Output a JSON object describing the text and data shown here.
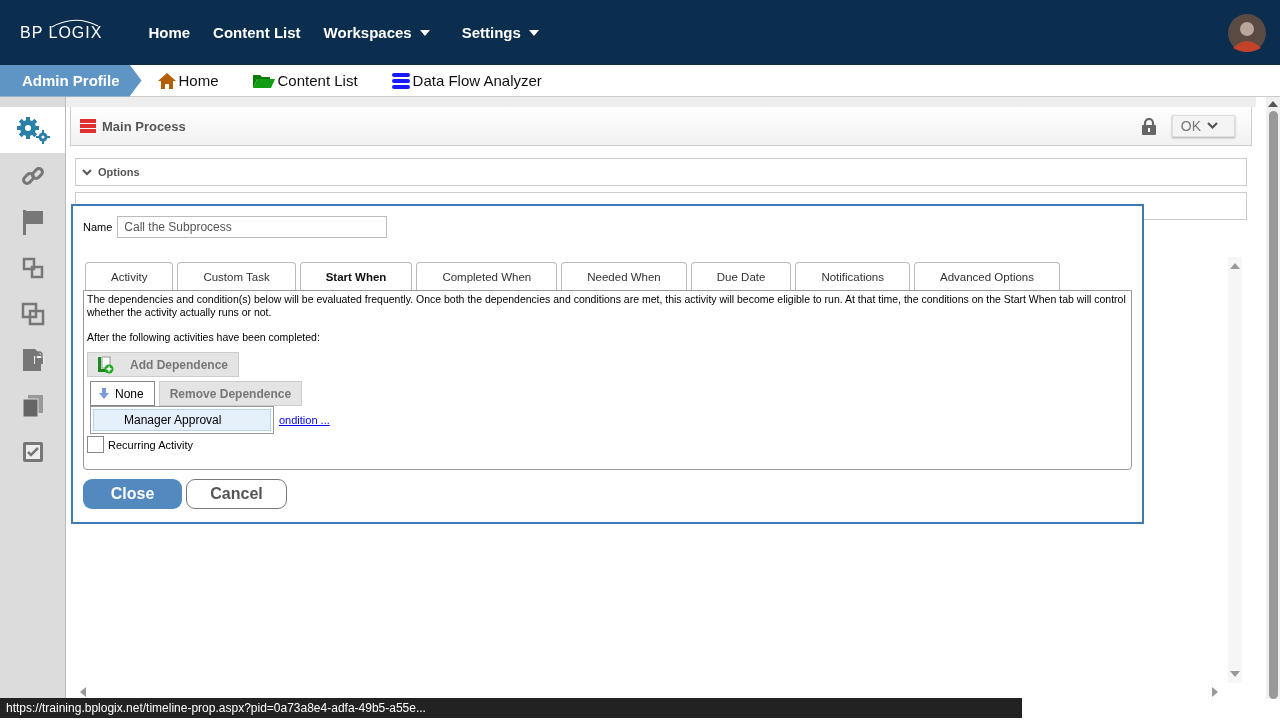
{
  "header": {
    "logo": "BP LOGIX",
    "nav": [
      {
        "label": "Home",
        "dropdown": false
      },
      {
        "label": "Content List",
        "dropdown": false
      },
      {
        "label": "Workspaces",
        "dropdown": true
      },
      {
        "label": "Settings",
        "dropdown": true
      }
    ]
  },
  "breadcrumb": {
    "profile": "Admin Profile",
    "links": [
      {
        "label": "Home",
        "kind": "home"
      },
      {
        "label": "Content List",
        "kind": "folder"
      },
      {
        "label": "Data Flow Analyzer",
        "kind": "database"
      }
    ]
  },
  "sidebar": {
    "items": [
      {
        "kind": "gears",
        "selected": true
      },
      {
        "kind": "link",
        "selected": false
      },
      {
        "kind": "flag",
        "selected": false
      },
      {
        "kind": "squares",
        "selected": false
      },
      {
        "kind": "overlap",
        "selected": false
      },
      {
        "kind": "lockdoc",
        "selected": false
      },
      {
        "kind": "copy",
        "selected": false
      },
      {
        "kind": "checkdoc",
        "selected": false
      }
    ]
  },
  "process": {
    "title": "Main Process",
    "ok_button": "OK"
  },
  "sections": [
    {
      "label": "Options"
    }
  ],
  "dialog": {
    "name_label": "Name",
    "name_value": "Call the Subprocess",
    "tabs": [
      {
        "label": "Activity",
        "selected": false
      },
      {
        "label": "Custom Task",
        "selected": false
      },
      {
        "label": "Start When",
        "selected": true
      },
      {
        "label": "Completed When",
        "selected": false
      },
      {
        "label": "Needed When",
        "selected": false
      },
      {
        "label": "Due Date",
        "selected": false
      },
      {
        "label": "Notifications",
        "selected": false
      },
      {
        "label": "Advanced Options",
        "selected": false
      }
    ],
    "description": "The dependencies and condition(s) below will be evaluated frequently. Once both the dependencies and conditions are met, this activity will become eligible to run. At that time, the conditions on the Start When tab will control whether the activity actually runs or not.",
    "after_text": "After the following activities have been completed:",
    "add_button": "Add Dependence",
    "dependence_value": "None",
    "remove_button": "Remove Dependence",
    "dropdown_options": [
      {
        "label": "Manager Approval",
        "selected": true
      }
    ],
    "condition_link": "ondition ...",
    "recurring": {
      "label": "Recurring Activity",
      "checked": false
    },
    "close_button": "Close",
    "cancel_button": "Cancel"
  },
  "status_url": "https://training.bplogix.net/timeline-prop.aspx?pid=0a73a8e4-adfa-49b5-a55e..."
}
